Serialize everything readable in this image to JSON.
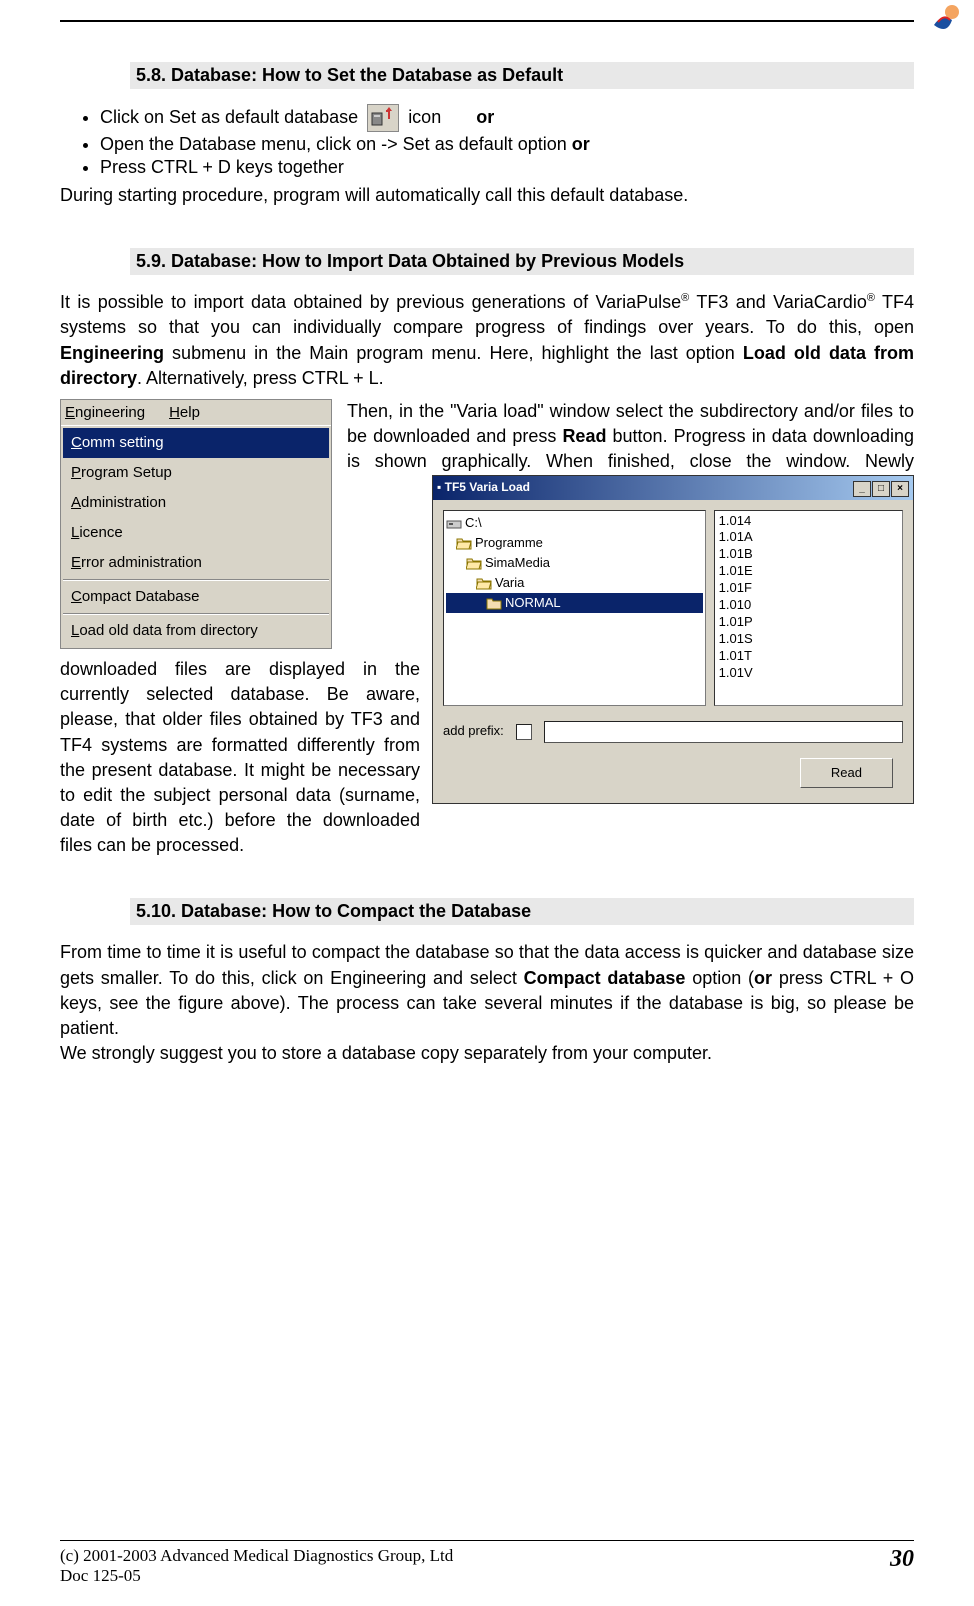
{
  "sections": {
    "s58": {
      "heading": "5.8. Database: How to Set the Database as Default",
      "bullets": [
        {
          "pre": "Click on Set as default database ",
          "mid": " icon ",
          "or": "or"
        },
        {
          "text": "Open the Database menu, click on -> Set as default option ",
          "or": "or"
        },
        {
          "text": "Press CTRL + D keys together"
        }
      ],
      "after": "During starting procedure, program will automatically call this default database."
    },
    "s59": {
      "heading": "5.9. Database: How to Import Data Obtained by Previous Models",
      "para1_a": "It is possible to import data obtained by previous generations of VariaPulse",
      "para1_b": " TF3 and VariaCardio",
      "para1_c": " TF4 systems so that you can individually compare progress of findings over years. To do this, open ",
      "para1_bold1": "Engineering",
      "para1_d": " submenu in the Main program menu. Here, highlight the last option ",
      "para1_bold2": "Load old data from directory",
      "para1_e": ". Alternatively, press CTRL + L.",
      "para2_a": "Then, in the \"Varia load\" window select the subdirectory and/or files to be downloaded and press ",
      "para2_bold": "Read",
      "para2_b": " button. Progress in data downloading is shown graphically. When finished, close the ",
      "para3": "window. Newly downloaded files are displayed in the currently selected database. Be aware, please, that older files obtained by TF3 and TF4 systems are formatted differently from the present database. It might be necessary to edit the subject personal data (surname, date of birth etc.) before the downloaded files can be processed.",
      "reg": "®"
    },
    "s510": {
      "heading": "5.10. Database: How to Compact the Database",
      "para_a": "From time to time it is useful to compact the database so that the data access is quicker and database size gets smaller. To do this, click on Engineering and select ",
      "para_bold1": "Compact database",
      "para_b": " option (",
      "para_bold2": "or",
      "para_c": " press CTRL + O keys, see the figure above). The process can take several minutes if the database is big, so please be patient.",
      "para_d": "We strongly suggest you to store a database copy separately from your computer."
    }
  },
  "menu_screenshot": {
    "menubar": {
      "engineering": "Engineering",
      "help": "Help"
    },
    "items": [
      "Comm setting",
      "Program Setup",
      "Administration",
      "Licence",
      "Error administration",
      "Compact Database",
      "Load old data from directory"
    ],
    "highlighted_index": 0,
    "separators_after": [
      4,
      5
    ]
  },
  "varia_window": {
    "title": "TF5 Varia Load",
    "folders": [
      "C:\\",
      "Programme",
      "SimaMedia",
      "Varia",
      "NORMAL"
    ],
    "selected_folder_index": 4,
    "files": [
      "1.014",
      "1.01A",
      "1.01B",
      "1.01E",
      "1.01F",
      "1.010",
      "1.01P",
      "1.01S",
      "1.01T",
      "1.01V"
    ],
    "add_prefix_label": "add prefix:",
    "read_button": "Read"
  },
  "footer": {
    "copyright": "(c) 2001-2003 Advanced Medical Diagnostics Group, Ltd",
    "doc": "Doc 125-05",
    "page": "30"
  },
  "icons": {
    "default_db": "set-default-database-icon",
    "logo": "company-logo-icon"
  }
}
